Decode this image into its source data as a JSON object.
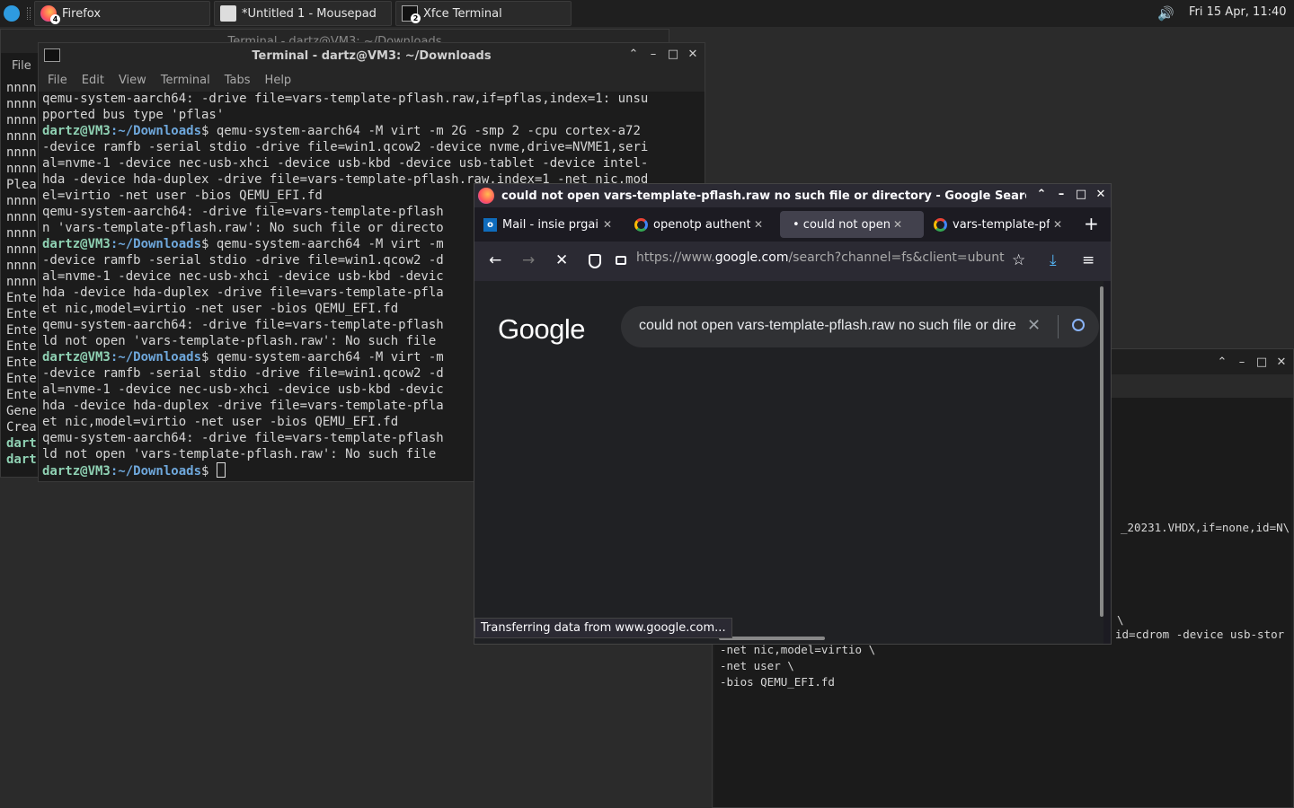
{
  "panel": {
    "apps": [
      {
        "label": "Firefox",
        "badge": "4"
      },
      {
        "label": "*Untitled 1 - Mousepad",
        "badge": ""
      },
      {
        "label": "Xfce Terminal",
        "badge": "2"
      }
    ],
    "volume_icon": "volume-icon",
    "clock": "Fri 15 Apr, 11:40"
  },
  "back_terminal": {
    "title": "Terminal - dartz@VM3: ~/Downloads",
    "menu_first": "File",
    "lines": [
      "nnnn",
      "nnnn",
      "nnnn",
      "nnnn",
      "nnnn",
      "nnnn",
      "Plea",
      "nnnn",
      "nnnn",
      "nnnn",
      "nnnn",
      "nnnn",
      "nnnn",
      "Ente",
      "Ente",
      "Ente",
      "Ente",
      "Ente",
      "Ente",
      "Ente",
      "Gene",
      "Crea",
      "dart",
      "dart"
    ]
  },
  "terminal": {
    "title": "Terminal - dartz@VM3: ~/Downloads",
    "menu": [
      "File",
      "Edit",
      "View",
      "Terminal",
      "Tabs",
      "Help"
    ],
    "prompt_user": "dartz@VM3",
    "prompt_path": ":~/Downloads",
    "lines": [
      {
        "type": "out",
        "text": "qemu-system-aarch64: -drive file=vars-template-pflash.raw,if=pflas,index=1: unsu"
      },
      {
        "type": "out",
        "text": "pported bus type 'pflas'"
      },
      {
        "type": "cmd",
        "text": "$ qemu-system-aarch64 -M virt -m 2G -smp 2 -cpu cortex-a72"
      },
      {
        "type": "out",
        "text": "-device ramfb -serial stdio -drive file=win1.qcow2 -device nvme,drive=NVME1,seri"
      },
      {
        "type": "out",
        "text": "al=nvme-1 -device nec-usb-xhci -device usb-kbd -device usb-tablet -device intel-"
      },
      {
        "type": "out",
        "text": "hda -device hda-duplex -drive file=vars-template-pflash.raw,index=1 -net nic,mod"
      },
      {
        "type": "out",
        "text": "el=virtio -net user -bios QEMU_EFI.fd"
      },
      {
        "type": "out",
        "text": "qemu-system-aarch64: -drive file=vars-template-pflash"
      },
      {
        "type": "out",
        "text": "n 'vars-template-pflash.raw': No such file or directo"
      },
      {
        "type": "cmd",
        "text": "$ qemu-system-aarch64 -M virt -m"
      },
      {
        "type": "out",
        "text": "-device ramfb -serial stdio -drive file=win1.qcow2 -d"
      },
      {
        "type": "out",
        "text": "al=nvme-1 -device nec-usb-xhci -device usb-kbd -devic"
      },
      {
        "type": "out",
        "text": "hda -device hda-duplex -drive file=vars-template-pfla"
      },
      {
        "type": "out",
        "text": "et nic,model=virtio -net user -bios QEMU_EFI.fd"
      },
      {
        "type": "out",
        "text": "qemu-system-aarch64: -drive file=vars-template-pflash"
      },
      {
        "type": "out",
        "text": "ld not open 'vars-template-pflash.raw': No such file"
      },
      {
        "type": "cmd",
        "text": "$ qemu-system-aarch64 -M virt -m"
      },
      {
        "type": "out",
        "text": "-device ramfb -serial stdio -drive file=win1.qcow2 -d"
      },
      {
        "type": "out",
        "text": "al=nvme-1 -device nec-usb-xhci -device usb-kbd -devic"
      },
      {
        "type": "out",
        "text": "hda -device hda-duplex -drive file=vars-template-pfla"
      },
      {
        "type": "out",
        "text": "et nic,model=virtio -net user -bios QEMU_EFI.fd"
      },
      {
        "type": "out",
        "text": "qemu-system-aarch64: -drive file=vars-template-pflash"
      },
      {
        "type": "out",
        "text": "ld not open 'vars-template-pflash.raw': No such file"
      },
      {
        "type": "cmd",
        "text": "$ "
      }
    ]
  },
  "editor": {
    "lines_right": [
      "_20231.VHDX,if=none,id=N\\",
      "\\",
      "id=cdrom -device usb-stor"
    ],
    "lines_bottom": [
      "-net nic,model=virtio \\",
      "-net user \\",
      "-bios QEMU_EFI.fd"
    ]
  },
  "firefox": {
    "title": "could not open vars-template-pflash.raw no such file or directory - Google Search — M",
    "tabs": [
      {
        "label": "Mail - insie prgai",
        "icon": "outlook-icon",
        "active": false
      },
      {
        "label": "openotp authent",
        "icon": "google-icon",
        "active": false
      },
      {
        "label": "• could not open v",
        "icon": "",
        "active": true
      },
      {
        "label": "vars-template-pfl",
        "icon": "google-icon",
        "active": false
      }
    ],
    "url_prefix": "https://www.",
    "url_domain": "google.com",
    "url_rest": "/search?channel=fs&client=ubunt",
    "google_logo": "Google",
    "search_query": "could not open vars-template-pflash.raw no such file or directory",
    "status": "Transferring data from www.google.com..."
  }
}
